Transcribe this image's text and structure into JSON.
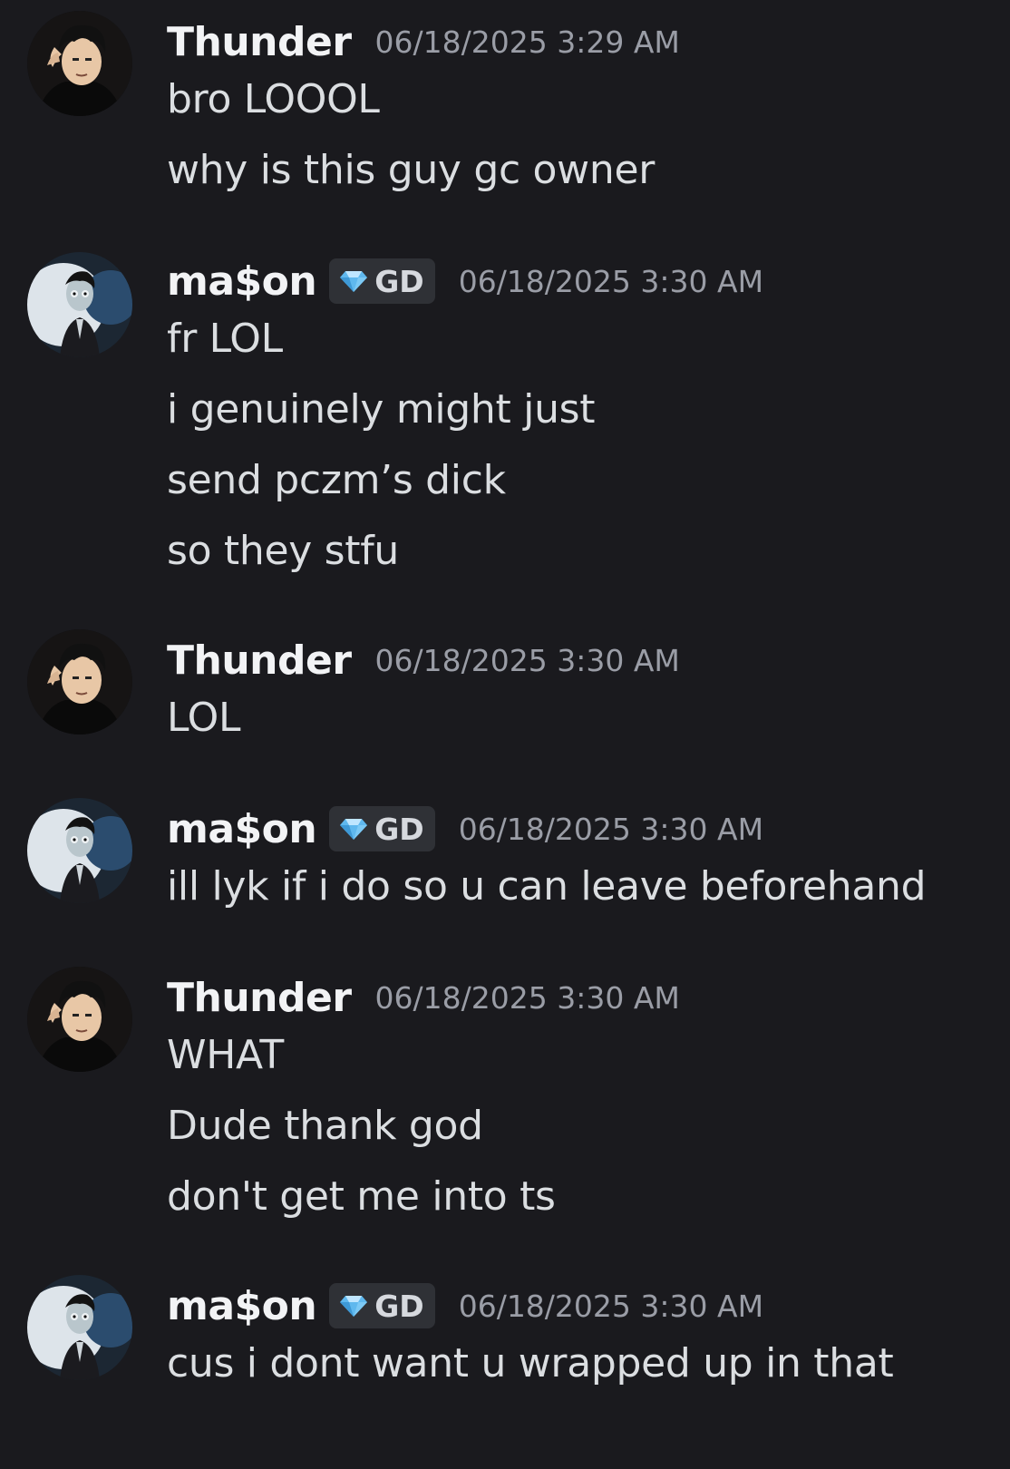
{
  "messages": [
    {
      "author": "Thunder",
      "avatar_icon": "thunder-avatar-icon",
      "tag": null,
      "timestamp": "06/18/2025 3:29 AM",
      "lines": [
        "bro LOOOL",
        "why is this guy gc owner"
      ]
    },
    {
      "author": "ma$on",
      "avatar_icon": "mason-avatar-icon",
      "tag": {
        "icon": "diamond-icon",
        "label": "GD"
      },
      "timestamp": "06/18/2025 3:30 AM",
      "lines": [
        "fr LOL",
        "i genuinely might just",
        "send pczm’s dick",
        "so they stfu"
      ]
    },
    {
      "author": "Thunder",
      "avatar_icon": "thunder-avatar-icon",
      "tag": null,
      "timestamp": "06/18/2025 3:30 AM",
      "lines": [
        "LOL"
      ]
    },
    {
      "author": "ma$on",
      "avatar_icon": "mason-avatar-icon",
      "tag": {
        "icon": "diamond-icon",
        "label": "GD"
      },
      "timestamp": "06/18/2025 3:30 AM",
      "lines": [
        "ill lyk if i do so u can leave beforehand"
      ]
    },
    {
      "author": "Thunder",
      "avatar_icon": "thunder-avatar-icon",
      "tag": null,
      "timestamp": "06/18/2025 3:30 AM",
      "lines": [
        "WHAT",
        "Dude thank god",
        "don't get me into ts"
      ]
    },
    {
      "author": "ma$on",
      "avatar_icon": "mason-avatar-icon",
      "tag": {
        "icon": "diamond-icon",
        "label": "GD"
      },
      "timestamp": "06/18/2025 3:30 AM",
      "lines": [
        "cus i dont want u wrapped up in that"
      ]
    }
  ],
  "colors": {
    "background": "#1a1a1e",
    "username": "#f2f3f5",
    "message_text": "#dbdee1",
    "timestamp": "#9a9da6",
    "tag_background": "#2f3136",
    "diamond": "#5fb8ee"
  }
}
